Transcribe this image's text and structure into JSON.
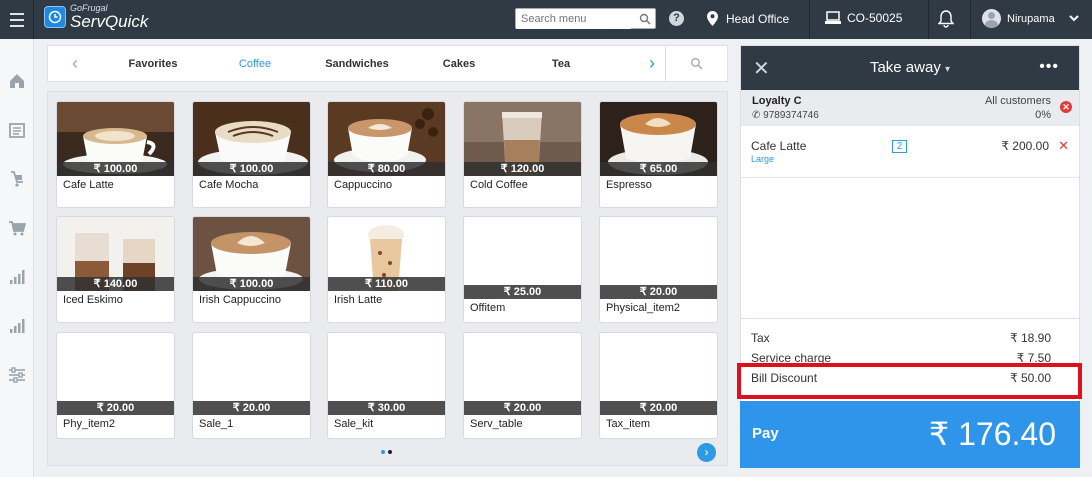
{
  "app": {
    "logo_small": "GoFrugal",
    "logo_big": "ServQuick"
  },
  "header": {
    "search_placeholder": "Search menu",
    "location": "Head Office",
    "terminal": "CO-50025",
    "user": "Nirupama"
  },
  "categories": [
    "Favorites",
    "Coffee",
    "Sandwiches",
    "Cakes",
    "Tea"
  ],
  "active_category": "Coffee",
  "products": [
    {
      "name": "Cafe Latte",
      "price": "₹ 100.00",
      "img": "latte"
    },
    {
      "name": "Cafe Mocha",
      "price": "₹ 100.00",
      "img": "mocha"
    },
    {
      "name": "Cappuccino",
      "price": "₹ 80.00",
      "img": "cappuccino"
    },
    {
      "name": "Cold Coffee",
      "price": "₹ 120.00",
      "img": "cold"
    },
    {
      "name": "Espresso",
      "price": "₹ 65.00",
      "img": "espresso"
    },
    {
      "name": "Iced Eskimo",
      "price": "₹ 140.00",
      "img": "iced"
    },
    {
      "name": "Irish Cappuccino",
      "price": "₹ 100.00",
      "img": "irishcap"
    },
    {
      "name": "Irish Latte",
      "price": "₹ 110.00",
      "img": "irishlatte"
    },
    {
      "name": "Offitem",
      "price": "₹ 25.00",
      "img": ""
    },
    {
      "name": "Physical_item2",
      "price": "₹ 20.00",
      "img": ""
    },
    {
      "name": "Phy_item2",
      "price": "₹ 20.00",
      "img": ""
    },
    {
      "name": "Sale_1",
      "price": "₹ 20.00",
      "img": ""
    },
    {
      "name": "Sale_kit",
      "price": "₹ 30.00",
      "img": ""
    },
    {
      "name": "Serv_table",
      "price": "₹ 20.00",
      "img": ""
    },
    {
      "name": "Tax_item",
      "price": "₹ 20.00",
      "img": ""
    }
  ],
  "order": {
    "title": "Take away",
    "customer": {
      "name": "Loyalty C",
      "phone": "9789374746",
      "group": "All customers",
      "discount": "0%"
    },
    "items": [
      {
        "name": "Cafe Latte",
        "variant": "Large",
        "qty": "2",
        "price": "₹ 200.00"
      }
    ],
    "tax": {
      "label": "Tax",
      "value": "₹ 18.90"
    },
    "service": {
      "label": "Service charge",
      "value": "₹ 7.50"
    },
    "discount": {
      "label": "Bill Discount",
      "value": "₹ 50.00"
    },
    "pay_label": "Pay",
    "total": "₹ 176.40"
  },
  "colors": {
    "accent": "#2c9be3",
    "header": "#2f3a44",
    "highlight": "#e0101b"
  }
}
